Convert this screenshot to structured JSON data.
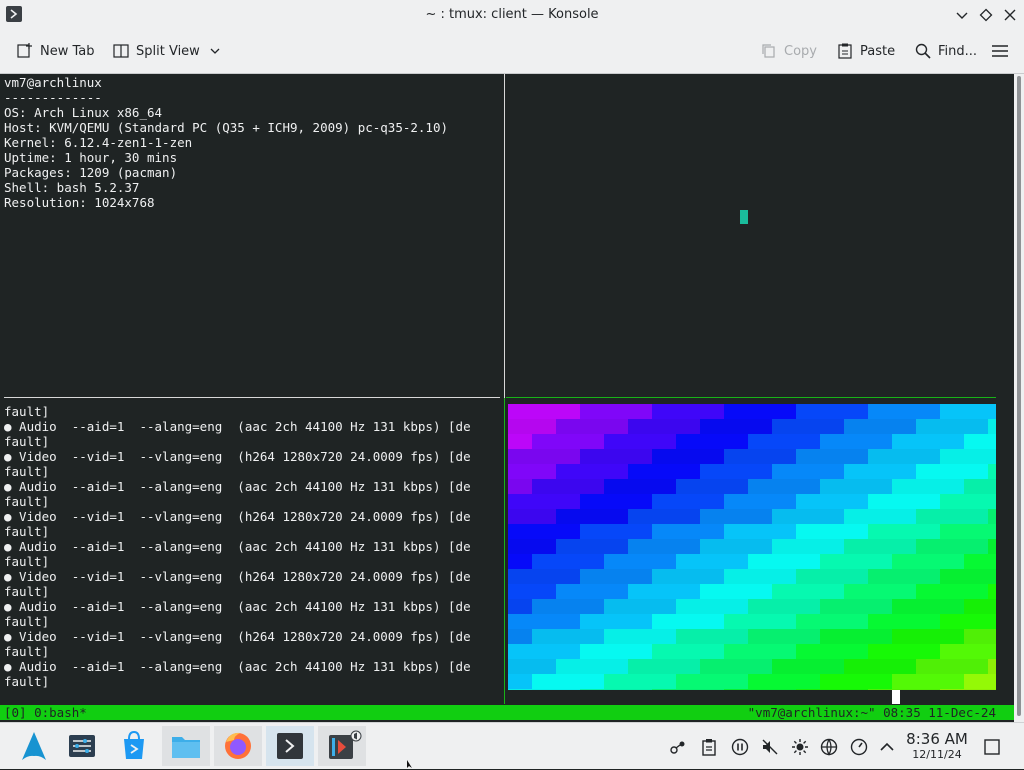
{
  "window": {
    "title": "~ : tmux: client — Konsole"
  },
  "toolbar": {
    "new_tab": "New Tab",
    "split_view": "Split View",
    "copy": "Copy",
    "paste": "Paste",
    "find": "Find..."
  },
  "pane_top_left": {
    "lines": [
      "vm7@archlinux",
      "-------------",
      "OS: Arch Linux x86_64",
      "Host: KVM/QEMU (Standard PC (Q35 + ICH9, 2009) pc-q35-2.10)",
      "Kernel: 6.12.4-zen1-1-zen",
      "Uptime: 1 hour, 30 mins",
      "Packages: 1209 (pacman)",
      "Shell: bash 5.2.37",
      "Resolution: 1024x768"
    ]
  },
  "pane_bottom_left": {
    "lines": [
      "fault]",
      "● Audio  --aid=1  --alang=eng  (aac 2ch 44100 Hz 131 kbps) [de",
      "fault]",
      "● Video  --vid=1  --vlang=eng  (h264 1280x720 24.0009 fps) [de",
      "fault]",
      "● Audio  --aid=1  --alang=eng  (aac 2ch 44100 Hz 131 kbps) [de",
      "fault]",
      "● Video  --vid=1  --vlang=eng  (h264 1280x720 24.0009 fps) [de",
      "fault]",
      "● Audio  --aid=1  --alang=eng  (aac 2ch 44100 Hz 131 kbps) [de",
      "fault]",
      "● Video  --vid=1  --vlang=eng  (h264 1280x720 24.0009 fps) [de",
      "fault]",
      "● Audio  --aid=1  --alang=eng  (aac 2ch 44100 Hz 131 kbps) [de",
      "fault]",
      "● Video  --vid=1  --vlang=eng  (h264 1280x720 24.0009 fps) [de",
      "fault]",
      "● Audio  --aid=1  --alang=eng  (aac 2ch 44100 Hz 131 kbps) [de",
      "fault]"
    ]
  },
  "tmux_status": {
    "left": "[0] 0:bash*",
    "right": "\"vm7@archlinux:~\" 08:35 11-Dec-24"
  },
  "taskbar": {
    "apps": [
      {
        "icon": "arch-launcher-icon"
      },
      {
        "icon": "system-settings-icon"
      },
      {
        "icon": "discover-store-icon"
      },
      {
        "icon": "file-manager-icon"
      },
      {
        "icon": "firefox-icon"
      },
      {
        "icon": "konsole-icon"
      },
      {
        "icon": "media-player-icon"
      }
    ],
    "clock_time": "8:36 AM",
    "clock_date": "12/11/24"
  },
  "colors": {
    "terminal_bg": "#1f2424",
    "tmux_green": "#11ce11",
    "cursor_teal": "#1abc9c"
  }
}
